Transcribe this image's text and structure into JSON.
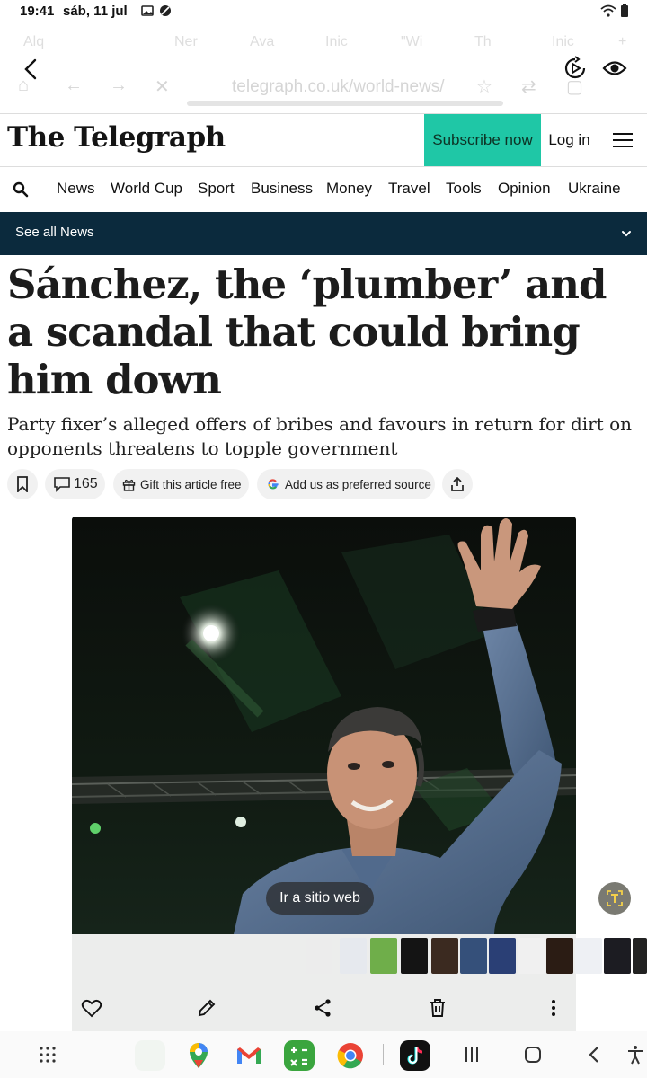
{
  "status_bar": {
    "time": "19:41",
    "date": "sáb, 11 jul"
  },
  "browser": {
    "ghost_tabs": [
      "Alq",
      "Ner",
      "Ava",
      "Inic",
      "\"Wi",
      "Th",
      "Inic"
    ],
    "url": "telegraph.co.uk/world-news/"
  },
  "site": {
    "logo": "The Telegraph",
    "subscribe_label": "Subscribe now",
    "login_label": "Log in",
    "nav_items": [
      "News",
      "World Cup",
      "Sport",
      "Business",
      "Money",
      "Travel",
      "Tools",
      "Opinion",
      "Ukraine"
    ],
    "see_all_label": "See all News",
    "accent_color": "#1fc7a6",
    "bar_color": "#0b2a3d"
  },
  "article": {
    "headline": "Sánchez, the ‘plumber’ and a scandal that could bring him down",
    "standfirst": "Party fixer’s alleged offers of bribes and favours in return for dirt on opponents threatens to topple government",
    "comments_count": "165",
    "gift_label": "Gift this article free",
    "source_label": "Add us as preferred source"
  },
  "viewer": {
    "visit_site_label": "Ir a sitio web"
  }
}
